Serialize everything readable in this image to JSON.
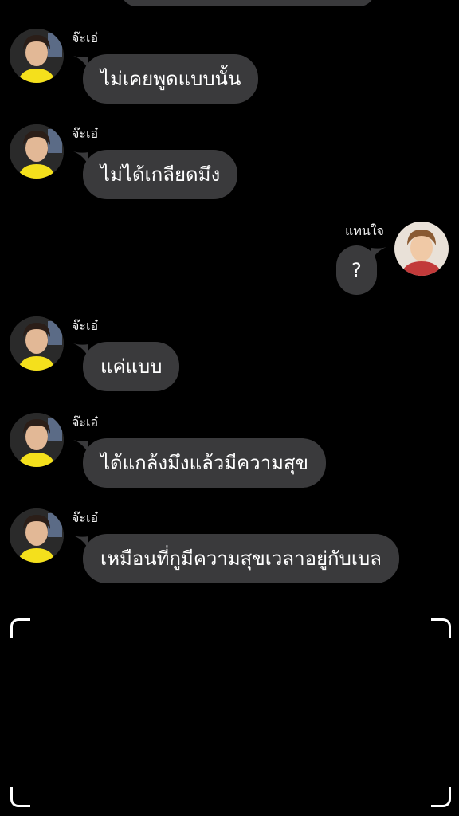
{
  "contacts": {
    "left_name": "จ๊ะเอ๋",
    "right_name": "แทนใจ"
  },
  "messages": [
    {
      "sender": "จ๊ะเอ๋",
      "text": "ไม่เคยพูดแบบนั้น"
    },
    {
      "sender": "จ๊ะเอ๋",
      "text": "ไม่ได้เกลียดมึง"
    },
    {
      "sender": "แทนใจ",
      "text": "?"
    },
    {
      "sender": "จ๊ะเอ๋",
      "text": "แค่แบบ"
    },
    {
      "sender": "จ๊ะเอ๋",
      "text": "ได้แกล้งมึงแล้วมีความสุข"
    },
    {
      "sender": "จ๊ะเอ๋",
      "text": "เหมือนที่กูมีความสุขเวลาอยู่กับเบล"
    }
  ],
  "colors": {
    "background": "#000000",
    "bubble": "#3a3a3c",
    "text": "#ffffff",
    "avatar_left_shirt": "#f4e01c"
  }
}
